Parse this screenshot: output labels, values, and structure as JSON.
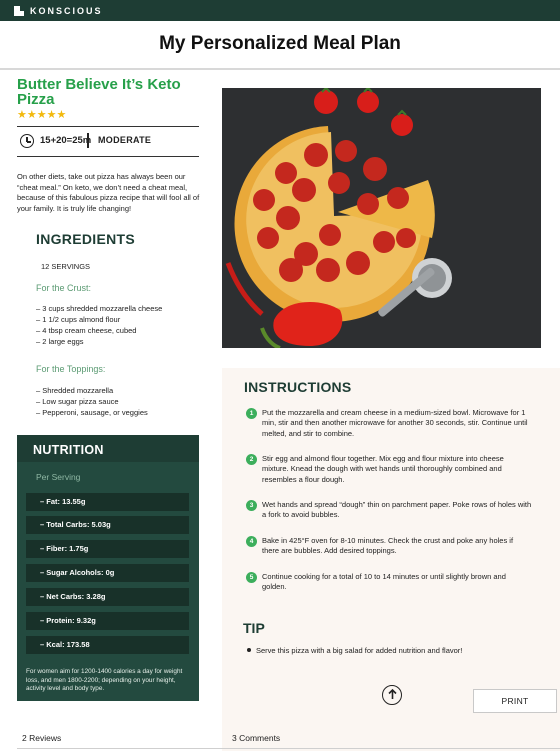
{
  "brand": {
    "name": "KONSCIOUS"
  },
  "page": {
    "title": "My Personalized Meal Plan"
  },
  "recipe": {
    "title": "Butter Believe It’s Keto Pizza",
    "rating": 5,
    "stars": "★★★★★",
    "time": "15+20=25m",
    "difficulty": "MODERATE",
    "intro": "On other diets, take out pizza has always been our “cheat meal.” On keto, we don’t need a cheat meal, because of this fabulous pizza recipe that will fool all of your family. It is truly life changing!"
  },
  "ingredients": {
    "heading": "INGREDIENTS",
    "servings": "12 SERVINGS",
    "groups": [
      {
        "title": "For the Crust:",
        "items": [
          "– 3 cups shredded mozzarella cheese",
          "– 1 1/2 cups almond flour",
          "– 4 tbsp cream cheese, cubed",
          "– 2 large eggs"
        ]
      },
      {
        "title": "For the Toppings:",
        "items": [
          "– Shredded mozzarella",
          "– Low sugar pizza sauce",
          "– Pepperoni, sausage, or veggies"
        ]
      }
    ]
  },
  "nutrition": {
    "heading": "NUTRITION",
    "per_serving": "Per Serving",
    "rows": [
      "– Fat: 13.55g",
      "– Total Carbs: 5.03g",
      "– Fiber: 1.75g",
      "– Sugar Alcohols: 0g",
      "– Net Carbs: 3.28g",
      "– Protein: 9.32g",
      "– Kcal: 173.58"
    ],
    "footnote": "For women aim for 1200-1400 calories a day for weight loss, and men 1800-2200; depending on your height, activity level and body type."
  },
  "instructions": {
    "heading": "INSTRUCTIONS",
    "steps": [
      {
        "num": "1",
        "text": "Put the mozzarella and cream cheese in a medium-sized bowl. Microwave for 1 min, stir and then another microwave for another 30 seconds, stir. Continue until melted, and stir to combine."
      },
      {
        "num": "2",
        "text": "Stir egg and almond flour together. Mix egg and flour mixture into cheese mixture. Knead the dough with wet hands until thoroughly combined and resembles a flour dough."
      },
      {
        "num": "3",
        "text": "Wet hands and spread “dough” thin on parchment paper. Poke rows of holes with a fork to avoid bubbles."
      },
      {
        "num": "4",
        "text": "Bake in 425°F oven for 8-10 minutes. Check the crust and poke any holes if there are bubbles. Add desired toppings."
      },
      {
        "num": "5",
        "text": "Continue cooking for a total of 10 to 14 minutes or until slightly brown and golden."
      }
    ]
  },
  "tip": {
    "heading": "TIP",
    "items": [
      "Serve this pizza with a big salad for added nutrition and flavor!"
    ]
  },
  "actions": {
    "print_label": "PRINT"
  },
  "footer": {
    "reviews": "2 Reviews",
    "comments": "3 Comments"
  },
  "colors": {
    "brand_dark": "#1e3d34",
    "accent_green": "#27a04a",
    "star": "#f2b90c",
    "step_green": "#3cae5c",
    "panel_bg": "#fbf6f2"
  }
}
